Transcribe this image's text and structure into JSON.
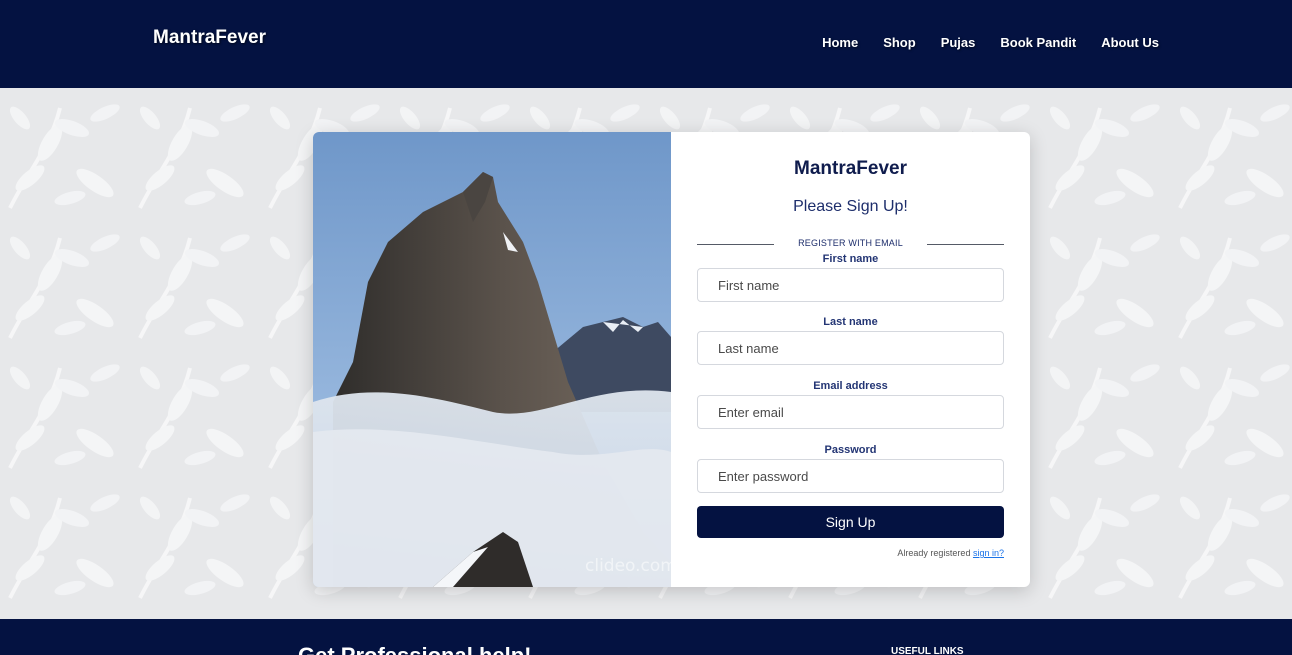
{
  "navbar": {
    "brand": "MantraFever",
    "links": [
      {
        "label": "Home"
      },
      {
        "label": "Shop"
      },
      {
        "label": "Pujas"
      },
      {
        "label": "Book Pandit"
      },
      {
        "label": "About Us"
      }
    ]
  },
  "image": {
    "watermark": "clideo.com"
  },
  "form": {
    "title": "MantraFever",
    "subtitle": "Please Sign Up!",
    "divider_text": "REGISTER WITH EMAIL",
    "fields": [
      {
        "label": "First name",
        "placeholder": "First name",
        "value": ""
      },
      {
        "label": "Last name",
        "placeholder": "Last name",
        "value": ""
      },
      {
        "label": "Email address",
        "placeholder": "Enter email",
        "value": ""
      },
      {
        "label": "Password",
        "placeholder": "Enter password",
        "value": ""
      }
    ],
    "submit_label": "Sign Up",
    "signin_prompt": "Already registered",
    "signin_link": "sign in?"
  },
  "footer": {
    "heading": "Get Professional help!",
    "links_title": "USEFUL LINKS"
  },
  "colors": {
    "primary": "#041241",
    "link": "#1a73e8",
    "background": "#e7e8ea"
  }
}
